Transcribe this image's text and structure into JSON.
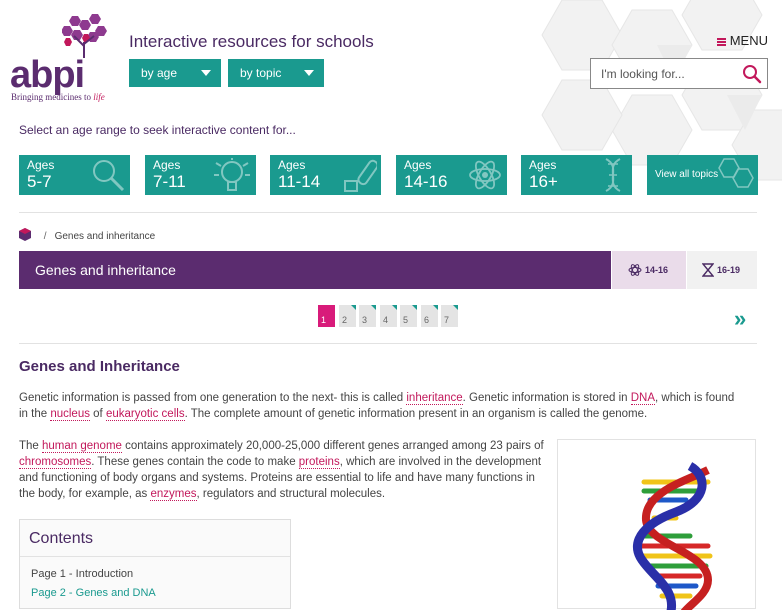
{
  "header": {
    "logo_text": "abpi",
    "logo_tagline_main": "Bringing medicines to",
    "logo_tagline_em": "life",
    "tagline": "Interactive resources for schools",
    "by_age_label": "by age",
    "by_topic_label": "by topic",
    "menu_label": "MENU",
    "search_placeholder": "I'm looking for..."
  },
  "age_prompt": "Select an age range to seek interactive content for...",
  "age_tiles": [
    {
      "ages": "Ages",
      "range": "5-7",
      "icon": "magnifier-icon"
    },
    {
      "ages": "Ages",
      "range": "7-11",
      "icon": "lightbulb-icon"
    },
    {
      "ages": "Ages",
      "range": "11-14",
      "icon": "test-tube-icon"
    },
    {
      "ages": "Ages",
      "range": "14-16",
      "icon": "atom-icon"
    },
    {
      "ages": "Ages",
      "range": "16+",
      "icon": "dna-icon"
    }
  ],
  "view_all_topics": "View all topics",
  "breadcrumb": {
    "separator": "/",
    "current": "Genes and inheritance"
  },
  "banner": {
    "title": "Genes and inheritance",
    "level_1": "14-16",
    "level_2": "16-19"
  },
  "pagination": {
    "pages": [
      "1",
      "2",
      "3",
      "4",
      "5",
      "6",
      "7"
    ],
    "current": "1",
    "next_label": "»"
  },
  "article": {
    "title": "Genes and Inheritance",
    "p1": {
      "t1": "Genetic information is passed from one generation to the next- this is called ",
      "l1": "inheritance",
      "t2": ". Genetic information is stored in ",
      "l2": "DNA",
      "t3": ", which is found in the ",
      "l3": "nucleus",
      "t4": " of ",
      "l4": "eukaryotic cells",
      "t5": ". The complete amount of genetic information present in an organism is called the genome."
    },
    "p2": {
      "t1": "The ",
      "l1": "human genome",
      "t2": " contains approximately 20,000-25,000 different genes arranged among 23 pairs of ",
      "l2": "chromosomes",
      "t3": ". These genes contain the code to make ",
      "l3": "proteins",
      "t4": ", which are involved in the development and functioning of body organs and systems. Proteins are essential to life and have many functions in the body, for example, as ",
      "l4": "enzymes",
      "t5": ", regulators and structural molecules."
    }
  },
  "contents": {
    "heading": "Contents",
    "items": [
      "Page 1 - Introduction",
      "Page 2 - Genes and DNA"
    ]
  },
  "colors": {
    "teal": "#1a9a8f",
    "purple": "#5b2c6f",
    "magenta": "#c2185b"
  }
}
